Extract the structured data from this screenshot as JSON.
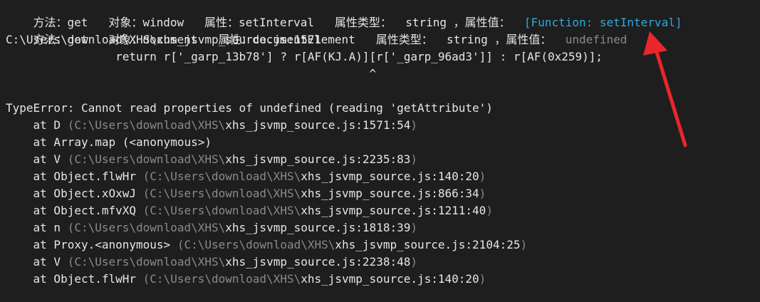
{
  "colors": {
    "background": "#1e1e1e",
    "text": "#e6e6e6",
    "muted": "#8a8a8a",
    "function": "#2fa8e0",
    "arrow": "#e8262c"
  },
  "log": [
    {
      "method_label": "方法：get   ",
      "object_label": "对象：window   ",
      "prop_label": "属性：setInterval   ",
      "type_label": "属性类型：  string ，",
      "value_label": "属性值：  ",
      "value": "[Function: setInterval]"
    },
    {
      "method_label": "方法：get   ",
      "object_label": "对象：document   ",
      "prop_label": "属性：documentElement   ",
      "type_label": "属性类型：  string ，",
      "value_label": "属性值：  ",
      "value": "undefined"
    }
  ],
  "source": {
    "location": "C:\\Users\\download\\XHS\\xhs_jsvmp_source.js:1571",
    "code": "                return r['_garp_13b78'] ? r[AF(KJ.A)][r['_garp_96ad3']] : r[AF(0x259)];",
    "caret": "                                                     ^"
  },
  "error": {
    "message": "TypeError: Cannot read properties of undefined (reading 'getAttribute')",
    "stack": [
      {
        "prefix": "    at D ",
        "dir": "(C:\\Users\\download\\XHS\\",
        "file": "xhs_jsvmp_source.js:1571:54",
        "close": ")"
      },
      {
        "prefix": "    at Array.map (<anonymous>)",
        "dir": "",
        "file": "",
        "close": ""
      },
      {
        "prefix": "    at V ",
        "dir": "(C:\\Users\\download\\XHS\\",
        "file": "xhs_jsvmp_source.js:2235:83",
        "close": ")"
      },
      {
        "prefix": "    at Object.flwHr ",
        "dir": "(C:\\Users\\download\\XHS\\",
        "file": "xhs_jsvmp_source.js:140:20",
        "close": ")"
      },
      {
        "prefix": "    at Object.xOxwJ ",
        "dir": "(C:\\Users\\download\\XHS\\",
        "file": "xhs_jsvmp_source.js:866:34",
        "close": ")"
      },
      {
        "prefix": "    at Object.mfvXQ ",
        "dir": "(C:\\Users\\download\\XHS\\",
        "file": "xhs_jsvmp_source.js:1211:40",
        "close": ")"
      },
      {
        "prefix": "    at n ",
        "dir": "(C:\\Users\\download\\XHS\\",
        "file": "xhs_jsvmp_source.js:1818:39",
        "close": ")"
      },
      {
        "prefix": "    at Proxy.<anonymous> ",
        "dir": "(C:\\Users\\download\\XHS\\",
        "file": "xhs_jsvmp_source.js:2104:25",
        "close": ")"
      },
      {
        "prefix": "    at V ",
        "dir": "(C:\\Users\\download\\XHS\\",
        "file": "xhs_jsvmp_source.js:2238:48",
        "close": ")"
      },
      {
        "prefix": "    at Object.flwHr ",
        "dir": "(C:\\Users\\download\\XHS\\",
        "file": "xhs_jsvmp_source.js:140:20",
        "close": ")"
      }
    ]
  }
}
